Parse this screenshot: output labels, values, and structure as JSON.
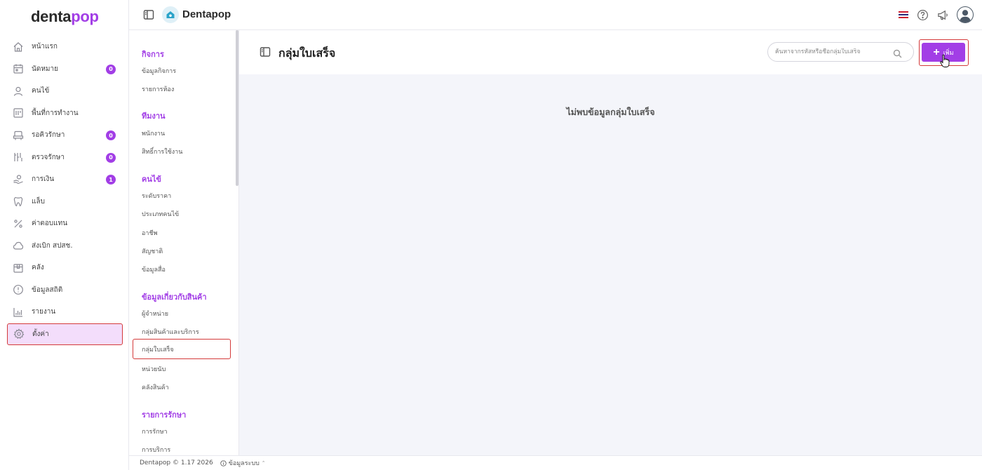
{
  "app": {
    "logo_prefix": "denta",
    "logo_suffix": "pop",
    "brand": "Dentapop"
  },
  "sidebar": {
    "items": [
      {
        "label": "หน้าแรก",
        "icon": "home-icon"
      },
      {
        "label": "นัดหมาย",
        "icon": "calendar-icon",
        "badge": "0"
      },
      {
        "label": "คนไข้",
        "icon": "user-icon"
      },
      {
        "label": "พื้นที่การทำงาน",
        "icon": "workspace-icon"
      },
      {
        "label": "รอคิวรักษา",
        "icon": "dental-chair-icon",
        "badge": "0"
      },
      {
        "label": "ตรวจรักษา",
        "icon": "dental-tools-icon",
        "badge": "0"
      },
      {
        "label": "การเงิน",
        "icon": "payment-icon",
        "badge": "1"
      },
      {
        "label": "แล็บ",
        "icon": "tooth-icon"
      },
      {
        "label": "ค่าตอบแทน",
        "icon": "percent-icon"
      },
      {
        "label": "ส่งเบิก สปสช.",
        "icon": "cloud-icon"
      },
      {
        "label": "คลัง",
        "icon": "box-icon"
      },
      {
        "label": "ข้อมูลสถิติ",
        "icon": "stats-icon"
      },
      {
        "label": "รายงาน",
        "icon": "report-chart-icon"
      },
      {
        "label": "ตั้งค่า",
        "icon": "gear-icon"
      }
    ]
  },
  "submenu": {
    "sections": [
      {
        "title": "กิจการ",
        "links": [
          "ข้อมูลกิจการ",
          "รายการห้อง"
        ]
      },
      {
        "title": "ทีมงาน",
        "links": [
          "พนักงาน",
          "สิทธิ์การใช้งาน"
        ]
      },
      {
        "title": "คนไข้",
        "links": [
          "ระดับราคา",
          "ประเภทคนไข้",
          "อาชีพ",
          "สัญชาติ",
          "ข้อมูลสื่อ"
        ]
      },
      {
        "title": "ข้อมูลเกี่ยวกับสินค้า",
        "links": [
          "ผู้จำหน่าย",
          "กลุ่มสินค้าและบริการ",
          "กลุ่มใบเสร็จ",
          "หน่วยนับ",
          "คลังสินค้า"
        ]
      },
      {
        "title": "รายการรักษา",
        "links": [
          "การรักษา",
          "การบริการ"
        ]
      }
    ]
  },
  "main": {
    "title": "กลุ่มใบเสร็จ",
    "search_placeholder": "ค้นหาจากรหัสหรือชื่อกลุ่มใบเสร็จ",
    "add_label": "เพิ่ม",
    "empty_message": "ไม่พบข้อมูลกลุ่มใบเสร็จ"
  },
  "footer": {
    "copyright": "Dentapop © 1.17 2026",
    "system_info": "ข้อมูลระบบ"
  },
  "colors": {
    "accent": "#a23ee6",
    "highlight_border": "#d43a3a",
    "active_bg": "#f3ddfb"
  }
}
